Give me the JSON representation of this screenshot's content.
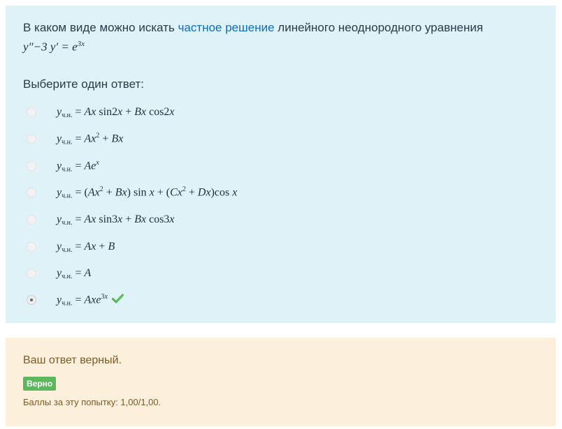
{
  "question": {
    "text_before": "В каком виде можно искать ",
    "link_text": "частное решение",
    "text_after": " линейного неоднородного уравнения",
    "equation_lhs": "y″−3 y′ = e",
    "equation_exp": "3x",
    "prompt": "Выберите один ответ:",
    "subscript": "ч.н.",
    "options": [
      {
        "selected": false,
        "correct": false
      },
      {
        "selected": false,
        "correct": false
      },
      {
        "selected": false,
        "correct": false
      },
      {
        "selected": false,
        "correct": false
      },
      {
        "selected": false,
        "correct": false
      },
      {
        "selected": false,
        "correct": false
      },
      {
        "selected": false,
        "correct": false
      },
      {
        "selected": true,
        "correct": true
      }
    ]
  },
  "outcome": {
    "feedback": "Ваш ответ верный.",
    "badge": "Верно",
    "mark": "Баллы за эту попытку: 1,00/1,00."
  },
  "colors": {
    "question_bg": "#def2f8",
    "outcome_bg": "#fcefdc",
    "badge_bg": "#5cb85c",
    "check_icon": "#5cb85c"
  }
}
